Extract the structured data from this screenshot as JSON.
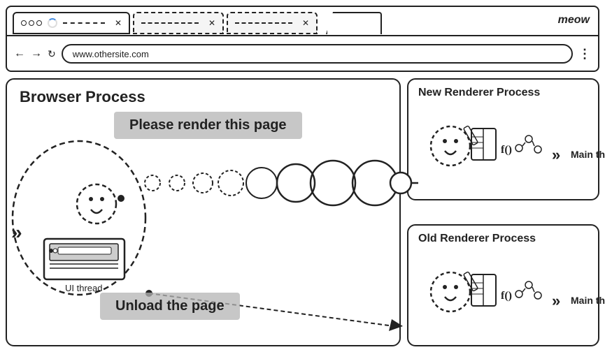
{
  "browser": {
    "tab1": {
      "url": "www.othersite.com",
      "active": true
    },
    "meow_label": "meow"
  },
  "diagram": {
    "browser_process_label": "Browser Process",
    "new_renderer_label": "New Renderer Process",
    "old_renderer_label": "Old Renderer Process",
    "render_banner": "Please render this page",
    "unload_banner": "Unload the page",
    "ui_thread_label": "UI thread",
    "main_thread_label": "Main thread",
    "main_thread_label2": "Main thread"
  }
}
